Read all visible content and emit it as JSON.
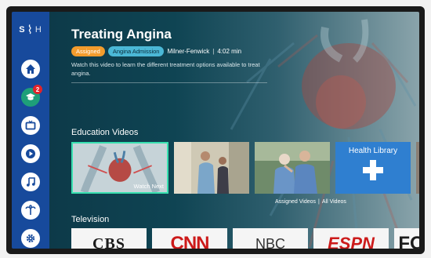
{
  "app": {
    "logo_left": "S",
    "logo_right": "H"
  },
  "header": {
    "title": "Treating Angina",
    "tags": [
      "Assigned",
      "Angina Admission"
    ],
    "provider": "Milner-Fenwick",
    "separator": "|",
    "duration": "4:02 min",
    "description": "Watch this video to learn the different treatment options available to treat angina."
  },
  "sidebar": {
    "items": [
      {
        "name": "home",
        "icon": "home-icon"
      },
      {
        "name": "education",
        "icon": "graduation-cap-icon",
        "badge": "2"
      },
      {
        "name": "tv",
        "icon": "tv-icon"
      },
      {
        "name": "video",
        "icon": "play-icon"
      },
      {
        "name": "music",
        "icon": "music-note-icon"
      },
      {
        "name": "relaxation",
        "icon": "palm-tree-icon"
      },
      {
        "name": "settings",
        "icon": "gear-icon"
      }
    ]
  },
  "education": {
    "section_title": "Education Videos",
    "watch_next_label": "Watch Next",
    "health_library_label": "Health Library",
    "links": [
      "Assigned Videos",
      "|",
      "All Videos"
    ]
  },
  "television": {
    "section_title": "Television",
    "channels": [
      "CBS",
      "CNN",
      "NBC",
      "ESPN",
      "FOX"
    ]
  },
  "colors": {
    "sidebar": "#174a9c",
    "accent": "#1e9f79",
    "assigned": "#f39c2d",
    "admission": "#4bb8d6",
    "library": "#2f7fd0"
  }
}
